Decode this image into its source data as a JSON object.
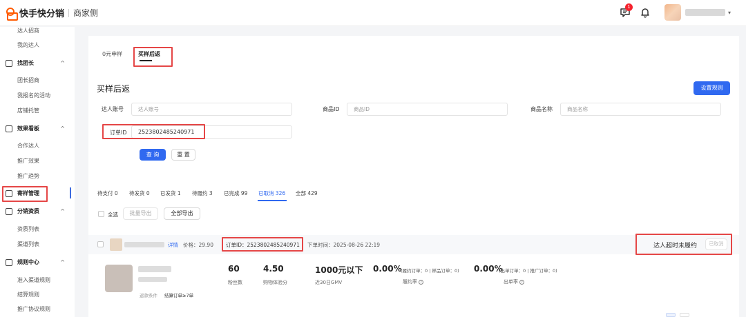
{
  "header": {
    "logo_text": "快手快分销",
    "portal": "商家侧",
    "message_count": "1"
  },
  "sidebar": {
    "items_top": [
      "达人招商",
      "我的达人"
    ],
    "groups": [
      {
        "label": "找团长",
        "icon": "flag-icon",
        "items": [
          "团长招商",
          "我报名的活动",
          "店铺托管"
        ]
      },
      {
        "label": "效果看板",
        "icon": "chart-icon",
        "items": [
          "合作达人",
          "推广效果",
          "推广趋势"
        ]
      },
      {
        "label": "寄样管理",
        "icon": "sample-icon",
        "items": []
      },
      {
        "label": "分销资质",
        "icon": "shield-icon",
        "items": [
          "资质列表",
          "渠道列表"
        ]
      },
      {
        "label": "规则中心",
        "icon": "rules-icon",
        "items": [
          "准入渠道规则",
          "结算规则",
          "推广协议规则"
        ]
      }
    ]
  },
  "tabs": [
    {
      "label": "0元申样",
      "active": false
    },
    {
      "label": "买样后返",
      "active": true
    }
  ],
  "page": {
    "title": "买样后返",
    "settings_button": "设置规则"
  },
  "filters": {
    "talent_account": {
      "label": "达人账号",
      "placeholder": "达人账号"
    },
    "product_id": {
      "label": "商品ID",
      "placeholder": "商品ID"
    },
    "product_name": {
      "label": "商品名称",
      "placeholder": "商品名称"
    },
    "order_id": {
      "label": "订单ID",
      "value": "2523802485240971"
    },
    "search_button": "查 询",
    "reset_button": "重 置"
  },
  "status_tabs": [
    {
      "label": "待支付 0"
    },
    {
      "label": "待发货 0"
    },
    {
      "label": "已发货 1"
    },
    {
      "label": "待履约 3"
    },
    {
      "label": "已完成 99"
    },
    {
      "label": "已取消 326",
      "active": true
    },
    {
      "label": "全部 429"
    }
  ],
  "bulk": {
    "select_all": "全选",
    "batch_export": "批量导出",
    "export_all": "全部导出"
  },
  "order": {
    "detail_link": "详情",
    "price": "价格：29.90",
    "order_id_text": "订单ID：2523802485240971",
    "order_time": "下单时间：2025-08-26 22:19",
    "status_reason": "达人超时未履约",
    "status_button": "已取消"
  },
  "talent": {
    "metrics": [
      {
        "value": "60",
        "label": "粉丝数"
      },
      {
        "value": "4.50",
        "label": "购物体验分"
      },
      {
        "value": "1000元以下",
        "label": "近30日GMV"
      },
      {
        "value": "0.00%",
        "sub": "(履约订单：0 | 样品订单：0)",
        "label": "履约率"
      },
      {
        "value": "0.00%",
        "sub": "(出单订单：0 | 推广订单：0)",
        "label": "出单率"
      }
    ],
    "return_condition_label": "返款条件",
    "return_condition_value": "结算订单≥7单"
  },
  "colors": {
    "primary": "#3069f0",
    "highlight": "#e54646",
    "logo": "#ff5b00"
  }
}
